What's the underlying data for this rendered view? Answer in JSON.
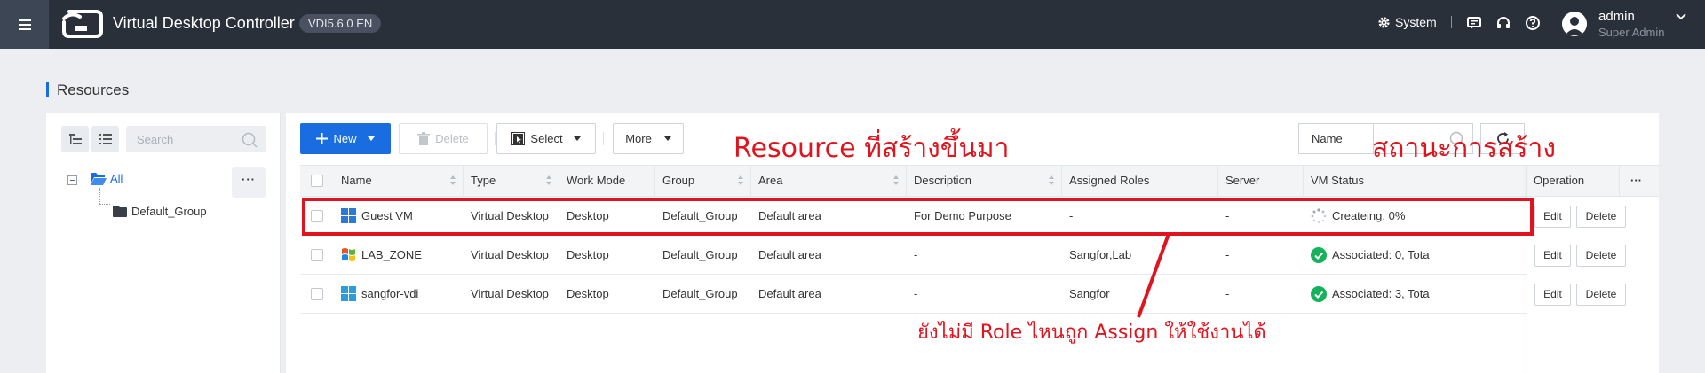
{
  "header": {
    "app_title": "Virtual Desktop Controller",
    "version": "VDI5.6.0 EN",
    "system_label": "System",
    "user": {
      "name": "admin",
      "role": "Super Admin"
    }
  },
  "page": {
    "title": "Resources"
  },
  "tree": {
    "search_placeholder": "Search",
    "root_label": "All",
    "more_label": "···",
    "children": [
      "Default_Group"
    ]
  },
  "toolbar": {
    "new_label": "New",
    "delete_label": "Delete",
    "select_label": "Select",
    "more_label": "More",
    "filter_field": "Name"
  },
  "table": {
    "columns": [
      "Name",
      "Type",
      "Work Mode",
      "Group",
      "Area",
      "Description",
      "Assigned Roles",
      "Server",
      "VM Status",
      "Operation"
    ],
    "op_menu": "···",
    "rows": [
      {
        "name": "Guest VM",
        "type": "Virtual Desktop",
        "work_mode": "Desktop",
        "group": "Default_Group",
        "area": "Default area",
        "description": "For Demo Purpose",
        "assigned_roles": "-",
        "server": "-",
        "vm_status": "Createing, 0%",
        "status_icon": "loading-icon",
        "os_icon": "windows10-icon"
      },
      {
        "name": "LAB_ZONE",
        "type": "Virtual Desktop",
        "work_mode": "Desktop",
        "group": "Default_Group",
        "area": "Default area",
        "description": "-",
        "assigned_roles": "Sangfor,Lab",
        "server": "-",
        "vm_status": "Associated: 0, Tota",
        "status_icon": "check-circle-icon",
        "os_icon": "windows-xp-icon"
      },
      {
        "name": "sangfor-vdi",
        "type": "Virtual Desktop",
        "work_mode": "Desktop",
        "group": "Default_Group",
        "area": "Default area",
        "description": "-",
        "assigned_roles": "Sangfor",
        "server": "-",
        "vm_status": "Associated: 3, Tota",
        "status_icon": "check-circle-icon",
        "os_icon": "windows10-icon"
      }
    ],
    "edit_label": "Edit",
    "delete_label": "Delete"
  },
  "annotations": {
    "created_resource": "Resource ที่สร้างขึ้นมา",
    "creation_status": "สถานะการสร้าง",
    "no_role": "ยังไม่มี Role ไหนถูก Assign ให้ใช้งานได้"
  },
  "colors": {
    "topbar": "#2a303a",
    "primary": "#1a6de0",
    "success": "#13b25b",
    "annotation": "#e0141e"
  }
}
